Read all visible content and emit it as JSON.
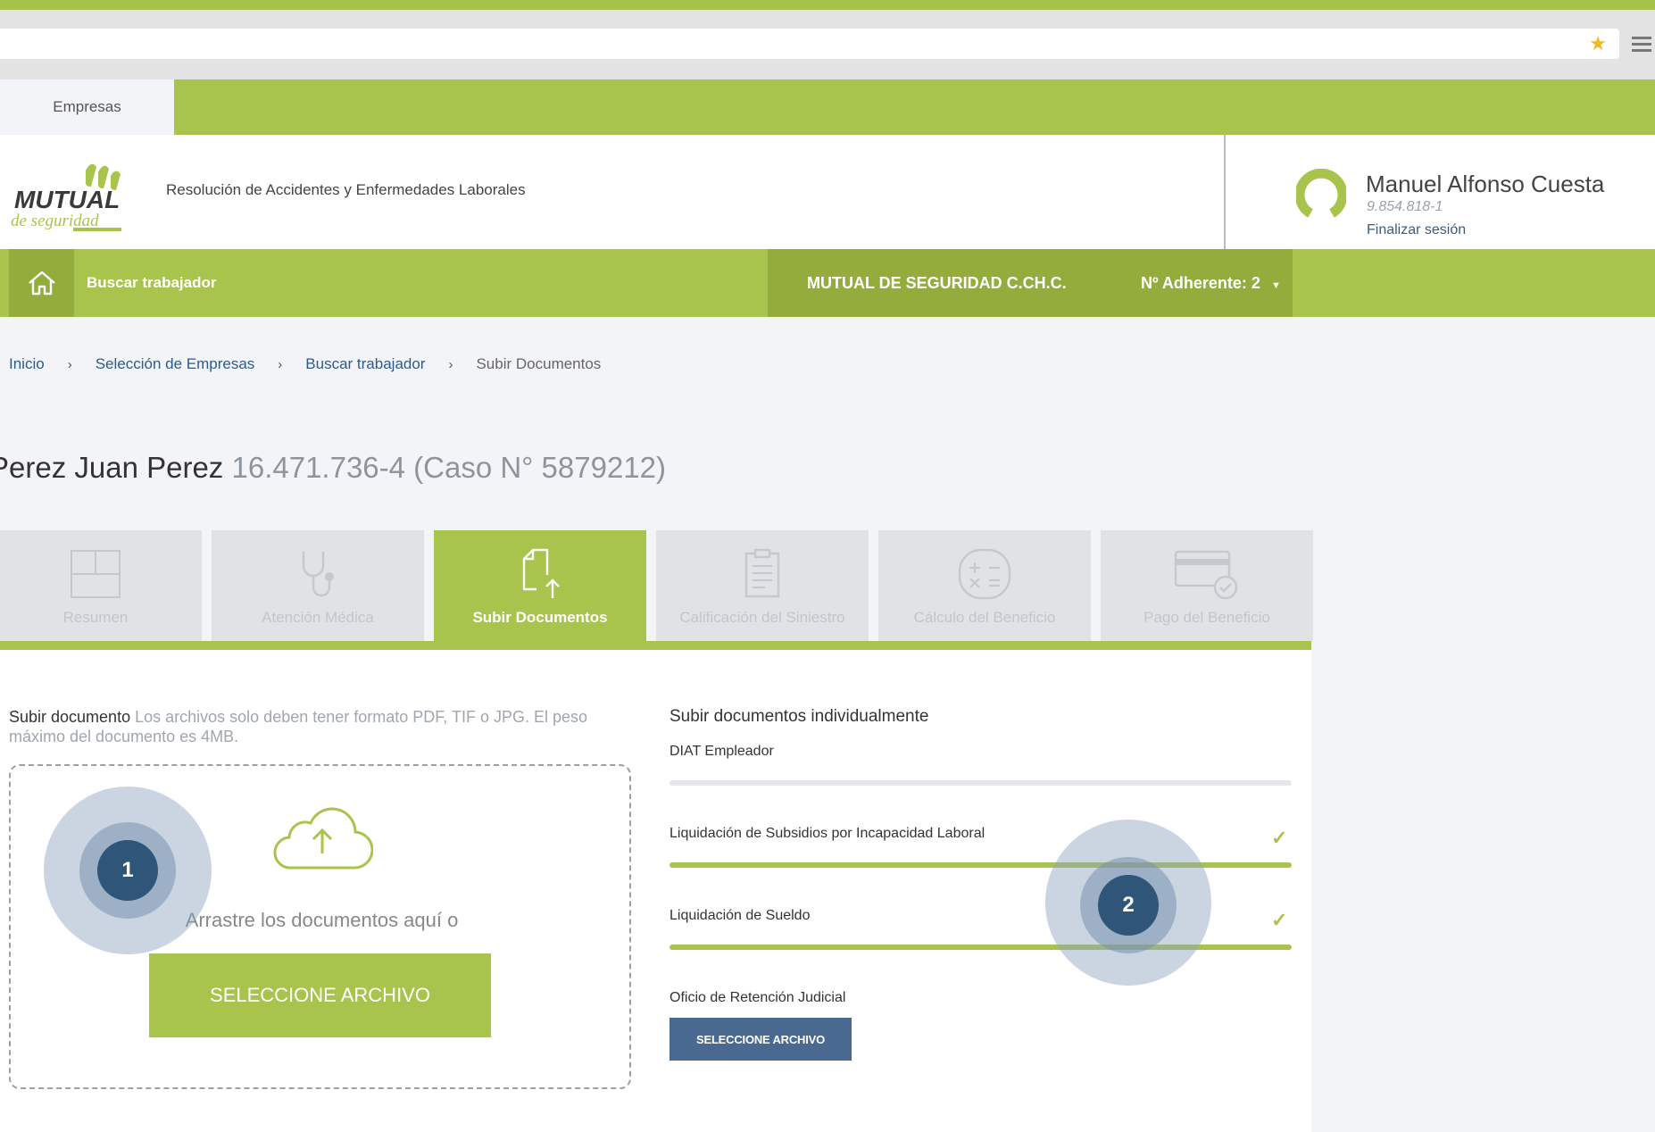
{
  "browser": {
    "accent_color": "#a7c14b",
    "star_icon": "star-icon",
    "menu_icon": "hamburger-menu-icon"
  },
  "top_tabs": [
    {
      "label": "Empresas",
      "active": true
    }
  ],
  "header": {
    "logo_icon": "mutual-de-seguridad-logo",
    "logo_text": [
      "MUTUAL",
      "de seguridad"
    ],
    "tagline": "Resolución de Accidentes y Enfermedades Laborales",
    "user": {
      "name": "Manuel Alfonso Cuesta",
      "rut": "9.854.818-1",
      "logout_label": "Finalizar sesión",
      "avatar_icon": "user-ring-icon"
    }
  },
  "navbar": {
    "home_icon": "home-icon",
    "search_label": "Buscar trabajador",
    "company": "MUTUAL DE SEGURIDAD C.CH.C.",
    "adherente_label": "Nº Adherente: 2",
    "bg_color": "#a9c44c"
  },
  "breadcrumb": {
    "items": [
      "Inicio",
      "Selección de Empresas",
      "Buscar trabajador"
    ],
    "current": "Subir Documentos",
    "separator": "›"
  },
  "page": {
    "title_name": "Perez Juan Perez",
    "title_sub": "16.471.736-4 (Caso N° 5879212)"
  },
  "steps": [
    {
      "label": "Resumen",
      "icon": "dashboard-icon",
      "active": false
    },
    {
      "label": "Atención Médica",
      "icon": "stethoscope-icon",
      "active": false
    },
    {
      "label": "Subir Documentos",
      "icon": "document-upload-icon",
      "active": true
    },
    {
      "label": "Calificación del Siniestro",
      "icon": "clipboard-icon",
      "active": false
    },
    {
      "label": "Cálculo del Beneficio",
      "icon": "calculator-icon",
      "active": false
    },
    {
      "label": "Pago del Beneficio",
      "icon": "payment-card-icon",
      "active": false
    }
  ],
  "upload": {
    "title": "Subir documento",
    "description": "Los archivos solo deben tener formato PDF, TIF o JPG. El peso máximo del documento es 4MB.",
    "drop_text": "Arrastre los documentos aquí o",
    "button_label": "SELECCIONE ARCHIVO",
    "cloud_icon": "cloud-upload-icon"
  },
  "individual": {
    "title": "Subir documentos individualmente",
    "documents": [
      {
        "label": "DIAT Empleador",
        "uploaded": false
      },
      {
        "label": "Liquidación de Subsidios por Incapacidad Laboral",
        "uploaded": true
      },
      {
        "label": "Liquidación de Sueldo",
        "uploaded": true
      },
      {
        "label": "Oficio de Retención Judicial",
        "uploaded": false
      }
    ],
    "button_label": "SELECCIONE ARCHIVO",
    "check_icon": "checkmark-icon"
  },
  "markers": [
    {
      "label": "1"
    },
    {
      "label": "2"
    }
  ]
}
